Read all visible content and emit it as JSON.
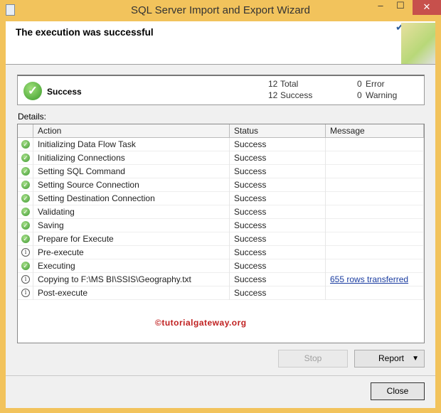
{
  "window": {
    "title": "SQL Server Import and Export Wizard",
    "minimize": "–",
    "maximize": "☐",
    "close": "✕"
  },
  "header": {
    "title": "The execution was successful"
  },
  "summary": {
    "status": "Success",
    "total_count": "12",
    "total_label": "Total",
    "success_count": "12",
    "success_label": "Success",
    "error_count": "0",
    "error_label": "Error",
    "warning_count": "0",
    "warning_label": "Warning"
  },
  "details_label": "Details:",
  "table": {
    "columns": [
      "Action",
      "Status",
      "Message"
    ],
    "rows": [
      {
        "icon": "success",
        "action": "Initializing Data Flow Task",
        "status": "Success",
        "message": ""
      },
      {
        "icon": "success",
        "action": "Initializing Connections",
        "status": "Success",
        "message": ""
      },
      {
        "icon": "success",
        "action": "Setting SQL Command",
        "status": "Success",
        "message": ""
      },
      {
        "icon": "success",
        "action": "Setting Source Connection",
        "status": "Success",
        "message": ""
      },
      {
        "icon": "success",
        "action": "Setting Destination Connection",
        "status": "Success",
        "message": ""
      },
      {
        "icon": "success",
        "action": "Validating",
        "status": "Success",
        "message": ""
      },
      {
        "icon": "success",
        "action": "Saving",
        "status": "Success",
        "message": ""
      },
      {
        "icon": "success",
        "action": "Prepare for Execute",
        "status": "Success",
        "message": ""
      },
      {
        "icon": "info",
        "action": "Pre-execute",
        "status": "Success",
        "message": ""
      },
      {
        "icon": "success",
        "action": "Executing",
        "status": "Success",
        "message": ""
      },
      {
        "icon": "info",
        "action": "Copying to F:\\MS BI\\SSIS\\Geography.txt",
        "status": "Success",
        "message": "655 rows transferred"
      },
      {
        "icon": "info",
        "action": "Post-execute",
        "status": "Success",
        "message": ""
      }
    ]
  },
  "watermark": "©tutorialgateway.org",
  "buttons": {
    "stop": "Stop",
    "report": "Report",
    "close": "Close"
  }
}
